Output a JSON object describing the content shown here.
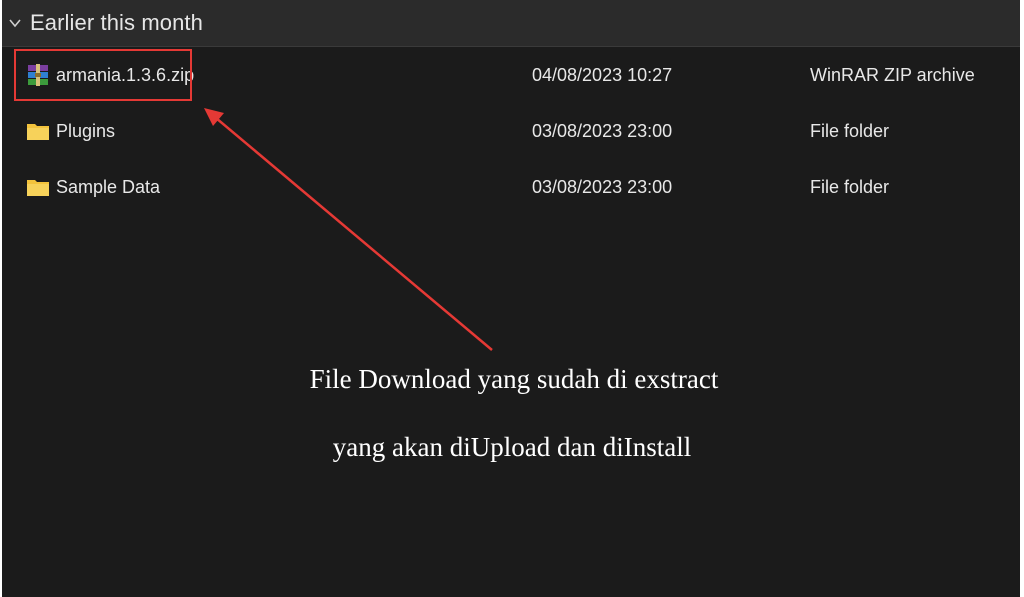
{
  "group": {
    "title": "Earlier this month"
  },
  "files": [
    {
      "name": "armania.1.3.6.zip",
      "date": "04/08/2023 10:27",
      "type": "WinRAR ZIP archive",
      "icon": "winrar-archive-icon"
    },
    {
      "name": "Plugins",
      "date": "03/08/2023 23:00",
      "type": "File folder",
      "icon": "folder-icon"
    },
    {
      "name": "Sample Data",
      "date": "03/08/2023 23:00",
      "type": "File folder",
      "icon": "folder-icon"
    }
  ],
  "annotation": {
    "line1": "File Download yang sudah di exstract",
    "line2": "yang akan diUpload dan diInstall",
    "color": "#e53935"
  },
  "colors": {
    "background": "#1b1b1b",
    "header": "#2b2b2b",
    "text": "#e8e8e8",
    "folder": "#f3c33c"
  }
}
